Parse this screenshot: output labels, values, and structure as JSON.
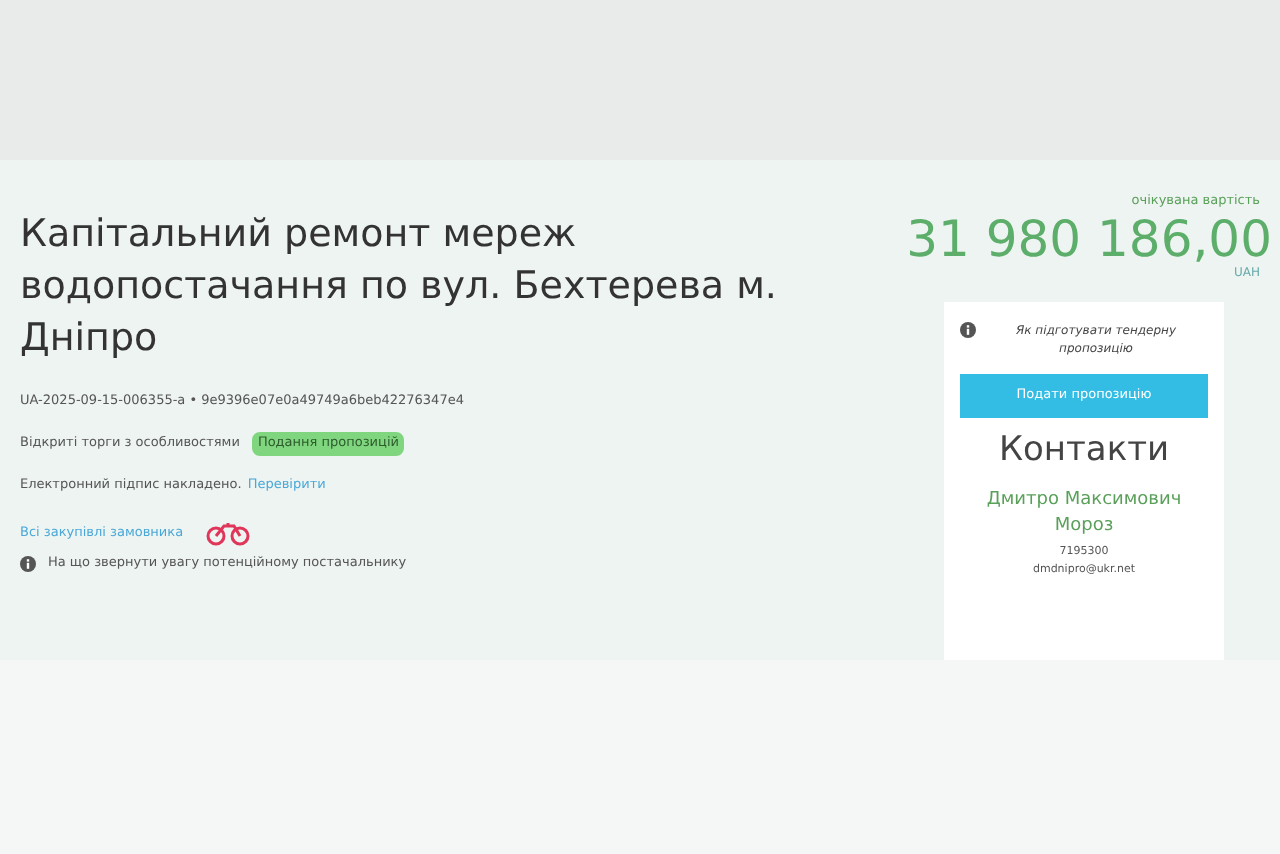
{
  "tender": {
    "title": "Капітальний ремонт мереж водопостачання по вул. Бехтерева м. Дніпро",
    "id_line": "UA-2025-09-15-006355-a • 9e9396e07e0a49749a6beb42276347e4",
    "procedure": "Відкриті торги з особливостями",
    "status_badge": "Подання пропозицій",
    "signature_text": "Електронний підпис накладено.",
    "signature_link": "Перевірити",
    "buyer_link": "Всі закупівлі замовника",
    "notice": "На що звернути увагу потенційному постачальнику"
  },
  "price": {
    "label": "очікувана вартість",
    "amount": "31 980 186,00",
    "currency": "UAH"
  },
  "sidebar": {
    "help": "Як підготувати тендерну пропозицію",
    "submit_button": "Подати пропозицію",
    "contacts_title": "Контакти",
    "contact_name": "Дмитро Максимович Мороз",
    "phone": "7195300",
    "email": "dmdnipro@ukr.net"
  }
}
